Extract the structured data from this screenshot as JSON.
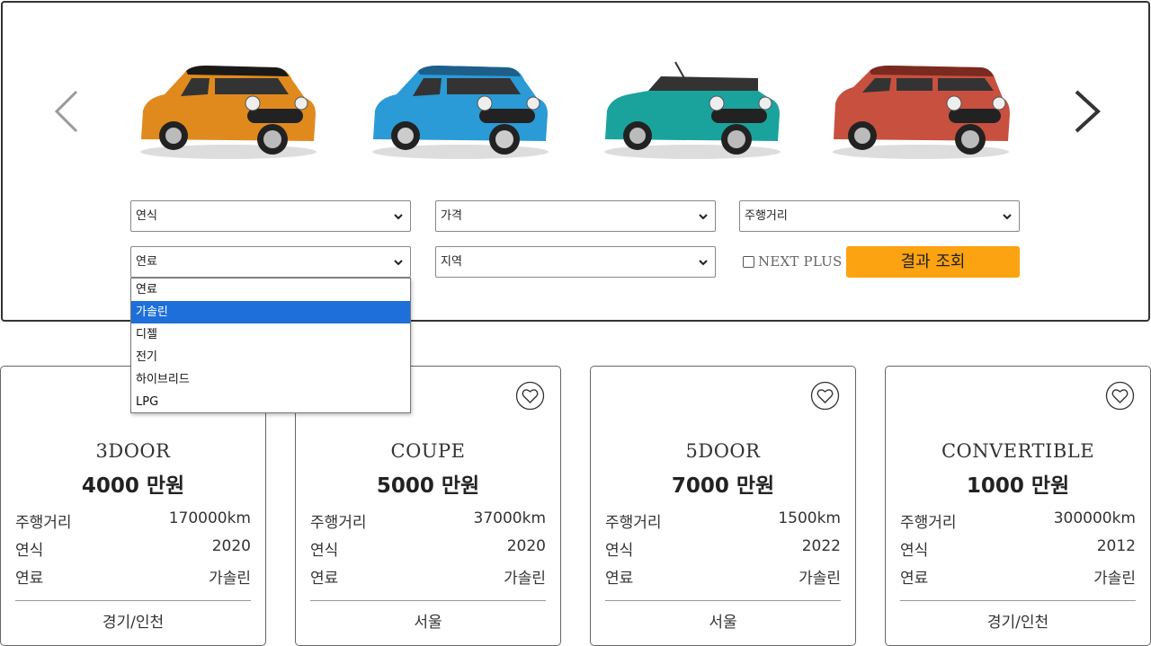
{
  "carousel": {
    "cars": [
      {
        "name": "orange-mini-3door",
        "body": "#e08a1e",
        "roof": "#1a1a1a"
      },
      {
        "name": "blue-mini-5door",
        "body": "#2a9bd6",
        "roof": "#1e5f8a"
      },
      {
        "name": "teal-mini-convertible",
        "body": "#1aa39c",
        "roof": "#1a1a1a"
      },
      {
        "name": "red-mini-clubman",
        "body": "#c8503e",
        "roof": "#7a2a20"
      }
    ],
    "prev_icon": "chevron-left-icon",
    "next_icon": "chevron-right-icon"
  },
  "filters": {
    "year": "연식",
    "price": "가격",
    "mileage": "주행거리",
    "fuel": "연료",
    "region": "지역",
    "next_plus": "NEXT PLUS",
    "search_button": "결과 조회"
  },
  "fuel_dropdown": {
    "options": [
      "연료",
      "가솔린",
      "디젤",
      "전기",
      "하이브리드",
      "LPG"
    ],
    "highlighted": "가솔린"
  },
  "cards": [
    {
      "model": "3DOOR",
      "price": "4000 만원",
      "mileage_label": "주행거리",
      "mileage": "170000km",
      "year_label": "연식",
      "year": "2020",
      "fuel_label": "연료",
      "fuel": "가솔린",
      "region": "경기/인천"
    },
    {
      "model": "COUPE",
      "price": "5000 만원",
      "mileage_label": "주행거리",
      "mileage": "37000km",
      "year_label": "연식",
      "year": "2020",
      "fuel_label": "연료",
      "fuel": "가솔린",
      "region": "서울"
    },
    {
      "model": "5DOOR",
      "price": "7000 만원",
      "mileage_label": "주행거리",
      "mileage": "1500km",
      "year_label": "연식",
      "year": "2022",
      "fuel_label": "연료",
      "fuel": "가솔린",
      "region": "서울"
    },
    {
      "model": "CONVERTIBLE",
      "price": "1000 만원",
      "mileage_label": "주행거리",
      "mileage": "300000km",
      "year_label": "연식",
      "year": "2012",
      "fuel_label": "연료",
      "fuel": "가솔린",
      "region": "경기/인천"
    }
  ],
  "colors": {
    "accent": "#fca311",
    "selection": "#1e6fd9"
  }
}
